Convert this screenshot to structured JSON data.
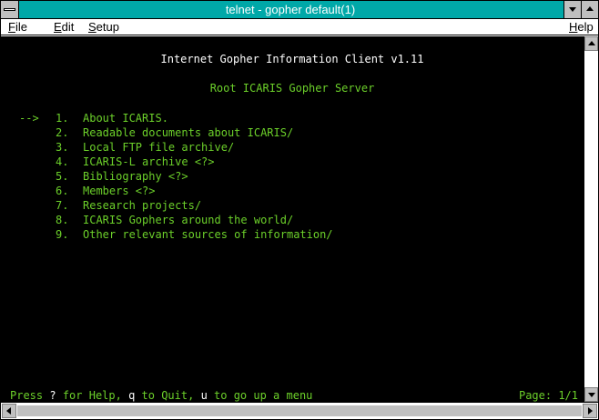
{
  "window": {
    "title": "telnet - gopher default(1)"
  },
  "menubar": {
    "items": [
      {
        "first": "F",
        "rest": "ile"
      },
      {
        "first": "E",
        "rest": "dit"
      },
      {
        "first": "S",
        "rest": "etup"
      },
      {
        "first": "H",
        "rest": "elp"
      }
    ]
  },
  "terminal": {
    "header": "Internet Gopher Information Client v1.11",
    "subheader": "Root ICARIS Gopher Server",
    "cursor": "-->",
    "items": [
      {
        "num": "1.",
        "label": "About ICARIS."
      },
      {
        "num": "2.",
        "label": "Readable documents about ICARIS/"
      },
      {
        "num": "3.",
        "label": "Local FTP file archive/"
      },
      {
        "num": "4.",
        "label": "ICARIS-L archive <?>"
      },
      {
        "num": "5.",
        "label": "Bibliography <?>"
      },
      {
        "num": "6.",
        "label": "Members <?>"
      },
      {
        "num": "7.",
        "label": "Research projects/"
      },
      {
        "num": "8.",
        "label": "ICARIS Gophers around the world/"
      },
      {
        "num": "9.",
        "label": "Other relevant sources of information/"
      }
    ],
    "status": {
      "press": "Press ",
      "key1": "?",
      "text1": " for Help, ",
      "key2": "q",
      "text2": " to Quit, ",
      "key3": "u",
      "text3": " to go up a menu"
    },
    "page": "Page: 1/1"
  },
  "colors": {
    "titlebar": "#00a8a8",
    "terminal_bg": "#000000",
    "terminal_fg": "#6cd02a",
    "terminal_header": "#ffffff"
  },
  "icons": [
    "system-menu-icon",
    "minimize-icon",
    "maximize-icon",
    "scroll-up-icon",
    "scroll-down-icon",
    "scroll-left-icon",
    "scroll-right-icon"
  ]
}
